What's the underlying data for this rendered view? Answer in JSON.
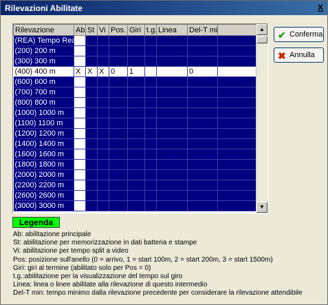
{
  "window": {
    "title": "Rilevazioni Abilitate",
    "close_label": "X"
  },
  "grid": {
    "columns": [
      "Rilevazione",
      "Ab",
      "St",
      "Vi",
      "Pos.",
      "Giri",
      "t.g.",
      "Linea",
      "Del-T min"
    ],
    "rows": [
      {
        "name": "(REA) Tempo Reazio",
        "ab": "",
        "st": "",
        "vi": "",
        "pos": "",
        "giri": "",
        "tg": "",
        "linea": "",
        "delt": ""
      },
      {
        "name": "(200) 200 m",
        "ab": "",
        "st": "",
        "vi": "",
        "pos": "",
        "giri": "",
        "tg": "",
        "linea": "",
        "delt": ""
      },
      {
        "name": "(300) 300 m",
        "ab": "",
        "st": "",
        "vi": "",
        "pos": "",
        "giri": "",
        "tg": "",
        "linea": "",
        "delt": ""
      },
      {
        "name": "(400) 400 m",
        "ab": "X",
        "st": "X",
        "vi": "X",
        "pos": "0",
        "giri": "1",
        "tg": "",
        "linea": "",
        "delt": "0"
      },
      {
        "name": "(600) 600 m",
        "ab": "",
        "st": "",
        "vi": "",
        "pos": "",
        "giri": "",
        "tg": "",
        "linea": "",
        "delt": ""
      },
      {
        "name": "(700) 700 m",
        "ab": "",
        "st": "",
        "vi": "",
        "pos": "",
        "giri": "",
        "tg": "",
        "linea": "",
        "delt": ""
      },
      {
        "name": "(800) 800 m",
        "ab": "",
        "st": "",
        "vi": "",
        "pos": "",
        "giri": "",
        "tg": "",
        "linea": "",
        "delt": ""
      },
      {
        "name": "(1000) 1000 m",
        "ab": "",
        "st": "",
        "vi": "",
        "pos": "",
        "giri": "",
        "tg": "",
        "linea": "",
        "delt": ""
      },
      {
        "name": "(1100) 1100 m",
        "ab": "",
        "st": "",
        "vi": "",
        "pos": "",
        "giri": "",
        "tg": "",
        "linea": "",
        "delt": ""
      },
      {
        "name": "(1200) 1200 m",
        "ab": "",
        "st": "",
        "vi": "",
        "pos": "",
        "giri": "",
        "tg": "",
        "linea": "",
        "delt": ""
      },
      {
        "name": "(1400) 1400 m",
        "ab": "",
        "st": "",
        "vi": "",
        "pos": "",
        "giri": "",
        "tg": "",
        "linea": "",
        "delt": ""
      },
      {
        "name": "(1600) 1600 m",
        "ab": "",
        "st": "",
        "vi": "",
        "pos": "",
        "giri": "",
        "tg": "",
        "linea": "",
        "delt": ""
      },
      {
        "name": "(1800) 1800 m",
        "ab": "",
        "st": "",
        "vi": "",
        "pos": "",
        "giri": "",
        "tg": "",
        "linea": "",
        "delt": ""
      },
      {
        "name": "(2000) 2000 m",
        "ab": "",
        "st": "",
        "vi": "",
        "pos": "",
        "giri": "",
        "tg": "",
        "linea": "",
        "delt": ""
      },
      {
        "name": "(2200) 2200 m",
        "ab": "",
        "st": "",
        "vi": "",
        "pos": "",
        "giri": "",
        "tg": "",
        "linea": "",
        "delt": ""
      },
      {
        "name": "(2600) 2600 m",
        "ab": "",
        "st": "",
        "vi": "",
        "pos": "",
        "giri": "",
        "tg": "",
        "linea": "",
        "delt": ""
      },
      {
        "name": "(3000) 3000 m",
        "ab": "",
        "st": "",
        "vi": "",
        "pos": "",
        "giri": "",
        "tg": "",
        "linea": "",
        "delt": ""
      }
    ]
  },
  "buttons": {
    "confirm_label": "Conferma",
    "confirm_icon": "check-icon",
    "cancel_label": "Annulla",
    "cancel_icon": "x-icon"
  },
  "legend": {
    "button_label": "Legenda",
    "lines": [
      "Ab: abilitazione principale",
      "St: abilitazione per memorizzazione in dati batteria e stampe",
      "Vi: abilitazione per tempo split a video",
      "Pos: posizione sull'anello (0 = arrivo, 1 = start 100m, 2 = start 200m, 3 = start 1500m)",
      "Giri: giri al termine (abilitato solo per Pos = 0)",
      "t.g.:abilitazione per la visualizzazione del tempo sul giro",
      "Linea: linea o linee abilitate alla rilevazione di questo intermedio",
      "Del-T min: tempo minimo dalla rilevazione precedente  per considerare la rilevazione attendibile"
    ]
  },
  "colors": {
    "grid_bg": "#000080",
    "legend_bg": "#00ff00",
    "confirm_icon_color": "#1e9e1e",
    "cancel_icon_color": "#cc2200"
  }
}
